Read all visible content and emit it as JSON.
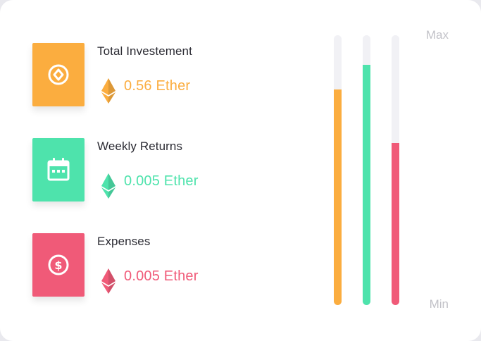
{
  "colors": {
    "orange": "#fbad3f",
    "green": "#4ee3ac",
    "red": "#f05a78",
    "track": "#f1f1f5"
  },
  "rows": [
    {
      "title": "Total Investement",
      "amount": "0.56 Ether",
      "icon": "diamond-coin-icon",
      "color": "#fbad3f"
    },
    {
      "title": "Weekly Returns",
      "amount": "0.005 Ether",
      "icon": "calendar-icon",
      "color": "#4ee3ac"
    },
    {
      "title": "Expenses",
      "amount": "0.005 Ether",
      "icon": "dollar-coin-icon",
      "color": "#f05a78"
    }
  ],
  "bars": {
    "max_label": "Max",
    "min_label": "Min",
    "levels": [
      {
        "color": "#fbad3f",
        "fraction": 0.8
      },
      {
        "color": "#4ee3ac",
        "fraction": 0.89
      },
      {
        "color": "#f05a78",
        "fraction": 0.6
      }
    ]
  }
}
